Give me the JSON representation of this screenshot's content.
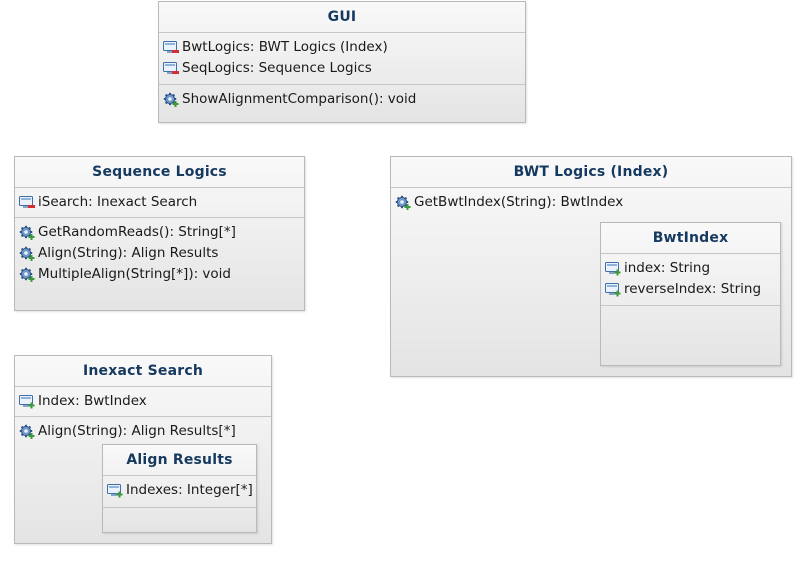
{
  "gui": {
    "title": "GUI",
    "attributes": [
      {
        "text": "BwtLogics: BWT Logics (Index)",
        "icon": "private-attribute-icon"
      },
      {
        "text": "SeqLogics: Sequence Logics",
        "icon": "private-attribute-icon"
      }
    ],
    "operations": [
      {
        "text": "ShowAlignmentComparison(): void",
        "icon": "public-operation-icon"
      }
    ]
  },
  "sequence_logics": {
    "title": "Sequence Logics",
    "attributes": [
      {
        "text": "iSearch: Inexact Search",
        "icon": "private-attribute-icon"
      }
    ],
    "operations": [
      {
        "text": "GetRandomReads(): String[*]",
        "icon": "public-operation-icon"
      },
      {
        "text": "Align(String): Align Results",
        "icon": "public-operation-icon"
      },
      {
        "text": "MultipleAlign(String[*]): void",
        "icon": "public-operation-icon"
      }
    ]
  },
  "bwt_logics": {
    "title": "BWT Logics (Index)",
    "operations": [
      {
        "text": "GetBwtIndex(String): BwtIndex",
        "icon": "public-operation-icon"
      }
    ]
  },
  "bwt_index": {
    "title": "BwtIndex",
    "attributes": [
      {
        "text": "index: String",
        "icon": "public-attribute-icon"
      },
      {
        "text": "reverseIndex: String",
        "icon": "public-attribute-icon"
      }
    ]
  },
  "inexact_search": {
    "title": "Inexact Search",
    "attributes": [
      {
        "text": "Index: BwtIndex",
        "icon": "public-attribute-icon"
      }
    ],
    "operations": [
      {
        "text": "Align(String): Align Results[*]",
        "icon": "public-operation-icon"
      }
    ]
  },
  "align_results": {
    "title": "Align Results",
    "attributes": [
      {
        "text": "Indexes: Integer[*]",
        "icon": "public-attribute-icon"
      }
    ]
  },
  "colors": {
    "title_text": "#15395f",
    "border": "#b9b9b9",
    "private_marker": "#d03030",
    "public_marker": "#3a9a3a",
    "gear": "#3f6fa8"
  }
}
